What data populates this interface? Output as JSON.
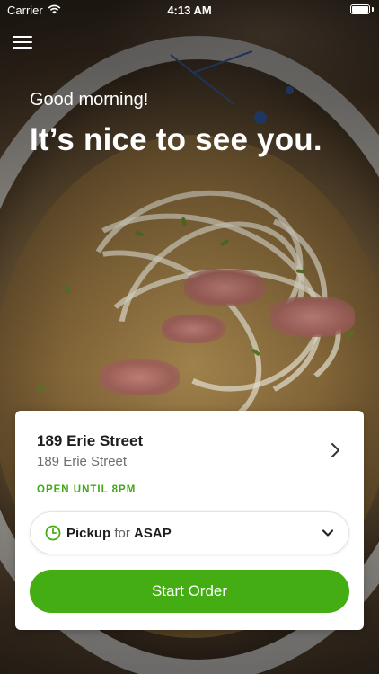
{
  "status_bar": {
    "carrier": "Carrier",
    "time": "4:13 AM",
    "wifi_icon": "wifi-icon",
    "battery_icon": "battery-icon"
  },
  "menu": {
    "icon": "hamburger-menu-icon"
  },
  "greeting": {
    "salutation": "Good morning!",
    "headline": "It’s nice to see you."
  },
  "location_card": {
    "name": "189 Erie Street",
    "address": "189 Erie Street",
    "open_status": "OPEN UNTIL 8PM",
    "chevron_icon": "chevron-right-icon",
    "order_type": {
      "icon": "clock-icon",
      "mode": "Pickup",
      "connector": "for",
      "time": "ASAP",
      "dropdown_icon": "chevron-down-icon"
    },
    "start_button_label": "Start Order"
  },
  "colors": {
    "accent_green": "#45ad14",
    "status_green": "#45a61a",
    "text_dark": "#1d1d1d",
    "text_muted": "#6d6d6d"
  }
}
